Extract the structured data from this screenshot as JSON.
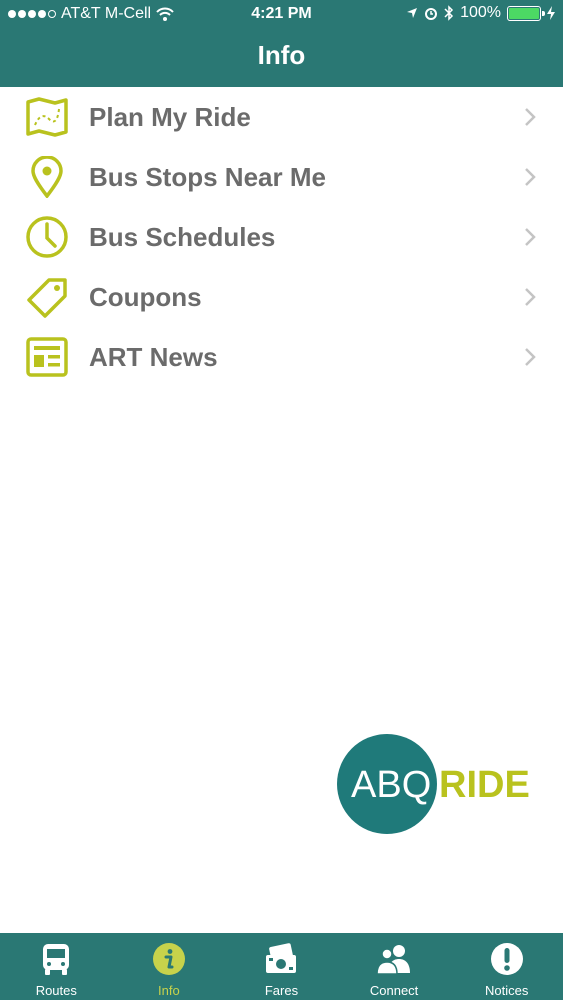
{
  "status_bar": {
    "carrier": "AT&T M-Cell",
    "time": "4:21 PM",
    "battery": "100%"
  },
  "nav": {
    "title": "Info"
  },
  "menu": {
    "items": [
      {
        "label": "Plan My Ride",
        "icon": "map-icon"
      },
      {
        "label": "Bus Stops Near Me",
        "icon": "location-pin-icon"
      },
      {
        "label": "Bus Schedules",
        "icon": "clock-icon"
      },
      {
        "label": "Coupons",
        "icon": "tag-icon"
      },
      {
        "label": "ART News",
        "icon": "news-icon"
      }
    ]
  },
  "logo": {
    "left": "ABQ",
    "right": "RIDE"
  },
  "tabbar": {
    "tabs": [
      {
        "label": "Routes",
        "icon": "bus-icon",
        "active": false
      },
      {
        "label": "Info",
        "icon": "info-icon",
        "active": true
      },
      {
        "label": "Fares",
        "icon": "fares-icon",
        "active": false
      },
      {
        "label": "Connect",
        "icon": "people-icon",
        "active": false
      },
      {
        "label": "Notices",
        "icon": "alert-icon",
        "active": false
      }
    ]
  },
  "colors": {
    "header": "#2a7874",
    "accent": "#b9c21e",
    "text": "#6b6b6b",
    "logo_teal": "#1f7a7a"
  }
}
